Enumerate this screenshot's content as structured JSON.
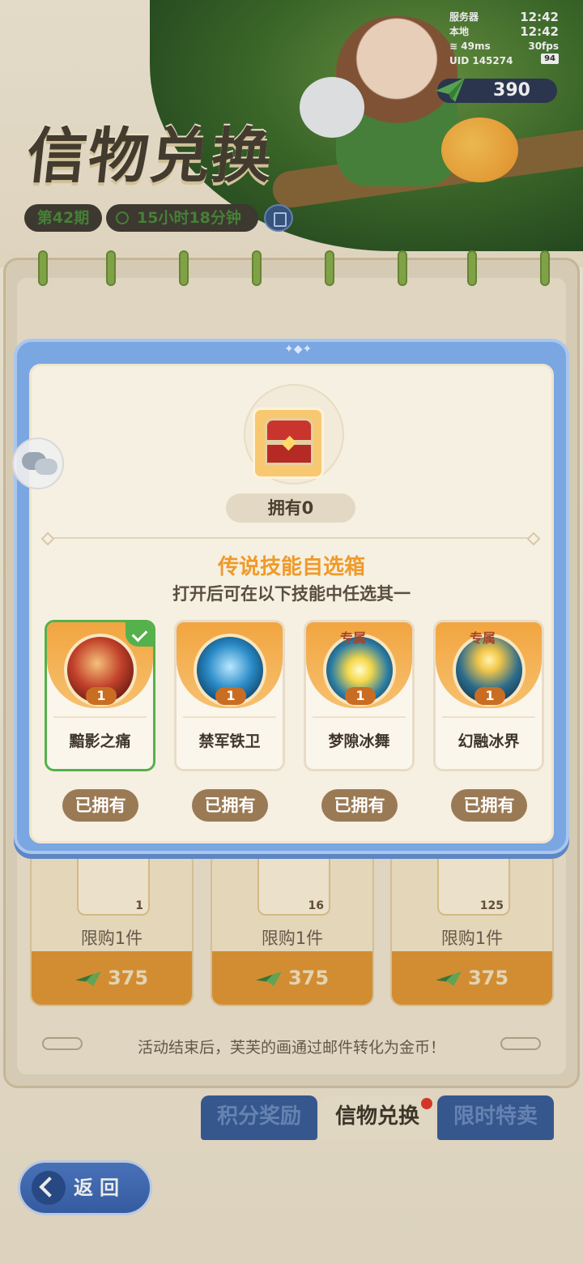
{
  "status": {
    "server_label": "服务器",
    "server_time": "12:42",
    "local_label": "本地",
    "local_time": "12:42",
    "ping": "49ms",
    "fps": "30fps",
    "uid": "UID 145274",
    "battery": "94"
  },
  "currency": {
    "amount": "390",
    "icon": "paper-plane-icon"
  },
  "header": {
    "title": "信物兑换",
    "period": "第42期",
    "timer": "15小时18分钟"
  },
  "shop": {
    "items": [
      {
        "qty": "1",
        "limit": "限购1件",
        "price": "375"
      },
      {
        "qty": "16",
        "limit": "限购1件",
        "price": "375"
      },
      {
        "qty": "125",
        "limit": "限购1件",
        "price": "375"
      }
    ],
    "note": "活动结束后，芙芙的画通过邮件转化为金币！"
  },
  "tabs": {
    "points": "积分奖励",
    "exchange": "信物兑换",
    "sale": "限时特卖"
  },
  "back_label": "返回",
  "modal": {
    "owned_count": "拥有0",
    "box_name": "传说技能自选箱",
    "box_desc": "打开后可在以下技能中任选其一",
    "skills": [
      {
        "name": "黯影之痛",
        "count": "1",
        "exclusive": "",
        "owned": "已拥有",
        "selected": true
      },
      {
        "name": "禁军铁卫",
        "count": "1",
        "exclusive": "",
        "owned": "已拥有",
        "selected": false
      },
      {
        "name": "梦隙冰舞",
        "count": "1",
        "exclusive": "专属",
        "owned": "已拥有",
        "selected": false
      },
      {
        "name": "幻融冰界",
        "count": "1",
        "exclusive": "专属",
        "owned": "已拥有",
        "selected": false
      }
    ]
  },
  "colors": {
    "accent_orange": "#ef9a2a",
    "selected_green": "#55b14b",
    "modal_blue": "#7aa6e2"
  }
}
